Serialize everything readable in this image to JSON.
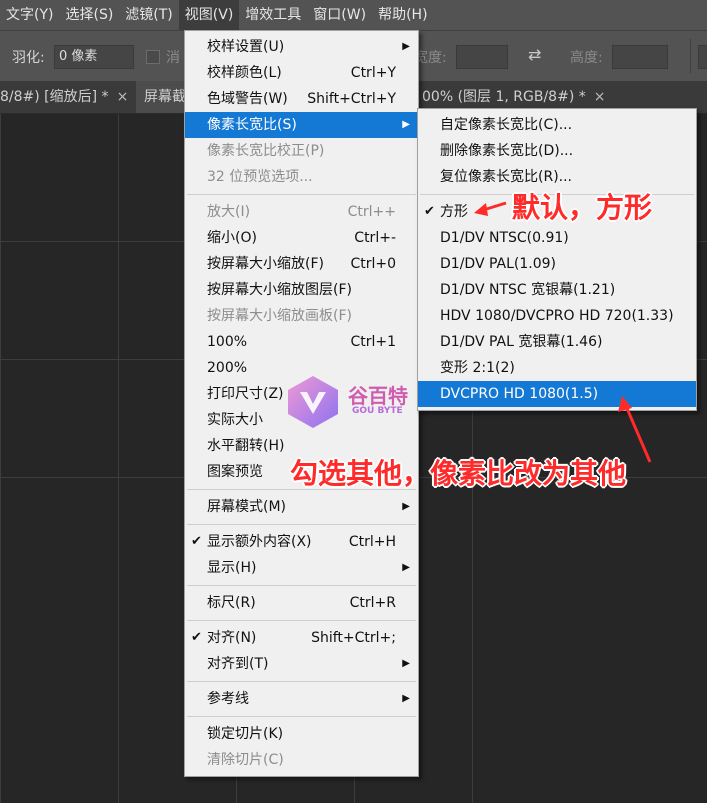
{
  "menubar": {
    "items": [
      "文字(Y)",
      "选择(S)",
      "滤镜(T)",
      "视图(V)",
      "增效工具",
      "窗口(W)",
      "帮助(H)"
    ],
    "active_index": 3
  },
  "options": {
    "feather_label": "羽化:",
    "feather_value": "0 像素",
    "antialias_label": "消",
    "width_label": "宽度:",
    "swap_icon": "swap-arrows-icon",
    "height_label": "高度:"
  },
  "tabs": [
    {
      "label": "8/8#) [缩放后] *",
      "close": "×"
    },
    {
      "label": "屏幕截",
      "close": ""
    },
    {
      "label": "00% (图层 1, RGB/8#) *",
      "close": "×"
    }
  ],
  "view_menu": {
    "items": [
      {
        "label": "校样设置(U)",
        "shortcut": "",
        "submenu": true,
        "disabled": false,
        "checked": false
      },
      {
        "label": "校样颜色(L)",
        "shortcut": "Ctrl+Y",
        "submenu": false,
        "disabled": false,
        "checked": false
      },
      {
        "label": "色域警告(W)",
        "shortcut": "Shift+Ctrl+Y",
        "submenu": false,
        "disabled": false,
        "checked": false
      },
      {
        "label": "像素长宽比(S)",
        "shortcut": "",
        "submenu": true,
        "disabled": false,
        "checked": false,
        "highlighted": true
      },
      {
        "label": "像素长宽比校正(P)",
        "shortcut": "",
        "submenu": false,
        "disabled": true,
        "checked": false
      },
      {
        "label": "32 位预览选项...",
        "shortcut": "",
        "submenu": false,
        "disabled": true,
        "checked": false,
        "sep_after": true
      },
      {
        "label": "放大(I)",
        "shortcut": "Ctrl++",
        "submenu": false,
        "disabled": true,
        "checked": false
      },
      {
        "label": "缩小(O)",
        "shortcut": "Ctrl+-",
        "submenu": false,
        "disabled": false,
        "checked": false
      },
      {
        "label": "按屏幕大小缩放(F)",
        "shortcut": "Ctrl+0",
        "submenu": false,
        "disabled": false,
        "checked": false
      },
      {
        "label": "按屏幕大小缩放图层(F)",
        "shortcut": "",
        "submenu": false,
        "disabled": false,
        "checked": false
      },
      {
        "label": "按屏幕大小缩放画板(F)",
        "shortcut": "",
        "submenu": false,
        "disabled": true,
        "checked": false
      },
      {
        "label": "100%",
        "shortcut": "Ctrl+1",
        "submenu": false,
        "disabled": false,
        "checked": false
      },
      {
        "label": "200%",
        "shortcut": "",
        "submenu": false,
        "disabled": false,
        "checked": false
      },
      {
        "label": "打印尺寸(Z)",
        "shortcut": "",
        "submenu": false,
        "disabled": false,
        "checked": false
      },
      {
        "label": "实际大小",
        "shortcut": "",
        "submenu": false,
        "disabled": false,
        "checked": false
      },
      {
        "label": "水平翻转(H)",
        "shortcut": "",
        "submenu": false,
        "disabled": false,
        "checked": false
      },
      {
        "label": "图案预览",
        "shortcut": "",
        "submenu": false,
        "disabled": false,
        "checked": false,
        "sep_after": true
      },
      {
        "label": "屏幕模式(M)",
        "shortcut": "",
        "submenu": true,
        "disabled": false,
        "checked": false,
        "sep_after": true
      },
      {
        "label": "显示额外内容(X)",
        "shortcut": "Ctrl+H",
        "submenu": false,
        "disabled": false,
        "checked": true
      },
      {
        "label": "显示(H)",
        "shortcut": "",
        "submenu": true,
        "disabled": false,
        "checked": false,
        "sep_after": true
      },
      {
        "label": "标尺(R)",
        "shortcut": "Ctrl+R",
        "submenu": false,
        "disabled": false,
        "checked": false,
        "sep_after": true
      },
      {
        "label": "对齐(N)",
        "shortcut": "Shift+Ctrl+;",
        "submenu": false,
        "disabled": false,
        "checked": true
      },
      {
        "label": "对齐到(T)",
        "shortcut": "",
        "submenu": true,
        "disabled": false,
        "checked": false,
        "sep_after": true
      },
      {
        "label": "参考线",
        "shortcut": "",
        "submenu": true,
        "disabled": false,
        "checked": false,
        "sep_after": true
      },
      {
        "label": "锁定切片(K)",
        "shortcut": "",
        "submenu": false,
        "disabled": false,
        "checked": false
      },
      {
        "label": "清除切片(C)",
        "shortcut": "",
        "submenu": false,
        "disabled": true,
        "checked": false
      }
    ]
  },
  "submenu": {
    "items": [
      {
        "label": "自定像素长宽比(C)...",
        "checked": false,
        "highlighted": false
      },
      {
        "label": "删除像素长宽比(D)...",
        "checked": false,
        "highlighted": false
      },
      {
        "label": "复位像素长宽比(R)...",
        "checked": false,
        "highlighted": false,
        "sep_after": true
      },
      {
        "label": "方形",
        "checked": true,
        "highlighted": false
      },
      {
        "label": "D1/DV NTSC(0.91)",
        "checked": false,
        "highlighted": false
      },
      {
        "label": "D1/DV PAL(1.09)",
        "checked": false,
        "highlighted": false
      },
      {
        "label": "D1/DV NTSC 宽银幕(1.21)",
        "checked": false,
        "highlighted": false
      },
      {
        "label": "HDV 1080/DVCPRO HD 720(1.33)",
        "checked": false,
        "highlighted": false
      },
      {
        "label": "D1/DV PAL 宽银幕(1.46)",
        "checked": false,
        "highlighted": false
      },
      {
        "label": "变形 2:1(2)",
        "checked": false,
        "highlighted": false
      },
      {
        "label": "DVCPRO HD 1080(1.5)",
        "checked": false,
        "highlighted": true
      }
    ]
  },
  "annotations": {
    "default_note": "默认，方形",
    "other_note": "勾选其他，像素比改为其他",
    "color": "#ff2a2a"
  },
  "watermark": {
    "brand_cn": "谷百特",
    "brand_en": "GOU BYTE"
  }
}
